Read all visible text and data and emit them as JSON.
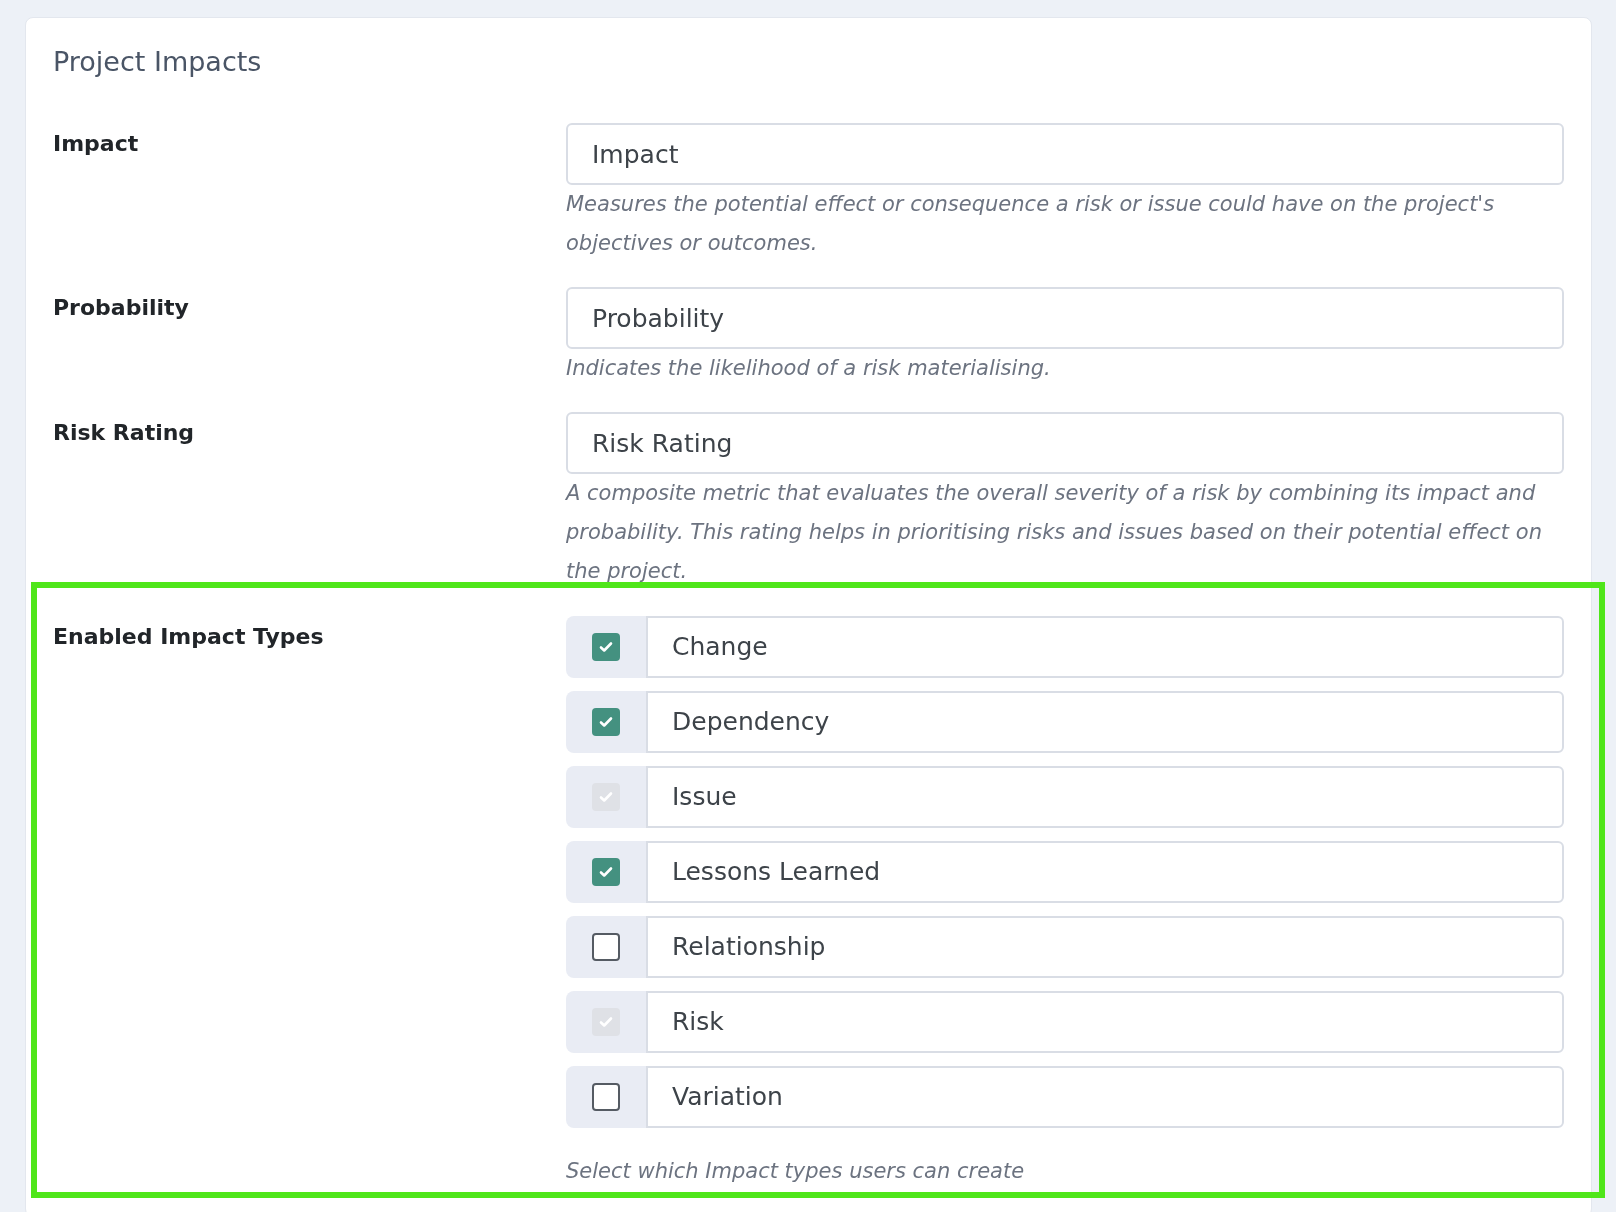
{
  "card": {
    "title": "Project Impacts"
  },
  "fields": [
    {
      "label": "Impact",
      "value": "Impact",
      "help": "Measures the potential effect or consequence a risk or issue could have on the project's objectives or outcomes."
    },
    {
      "label": "Probability",
      "value": "Probability",
      "help": "Indicates the likelihood of a risk materialising."
    },
    {
      "label": "Risk Rating",
      "value": "Risk Rating",
      "help": "A composite metric that evaluates the overall severity of a risk by combining its impact and probability. This rating helps in prioritising risks and issues based on their potential effect on the project."
    }
  ],
  "impact_types": {
    "label": "Enabled Impact Types",
    "help": "Select which Impact types users can create",
    "highlighted": true,
    "options": [
      {
        "label": "Change",
        "checked": true,
        "disabled": false
      },
      {
        "label": "Dependency",
        "checked": true,
        "disabled": false
      },
      {
        "label": "Issue",
        "checked": true,
        "disabled": true
      },
      {
        "label": "Lessons Learned",
        "checked": true,
        "disabled": false
      },
      {
        "label": "Relationship",
        "checked": false,
        "disabled": false
      },
      {
        "label": "Risk",
        "checked": true,
        "disabled": true
      },
      {
        "label": "Variation",
        "checked": false,
        "disabled": false
      }
    ]
  }
}
